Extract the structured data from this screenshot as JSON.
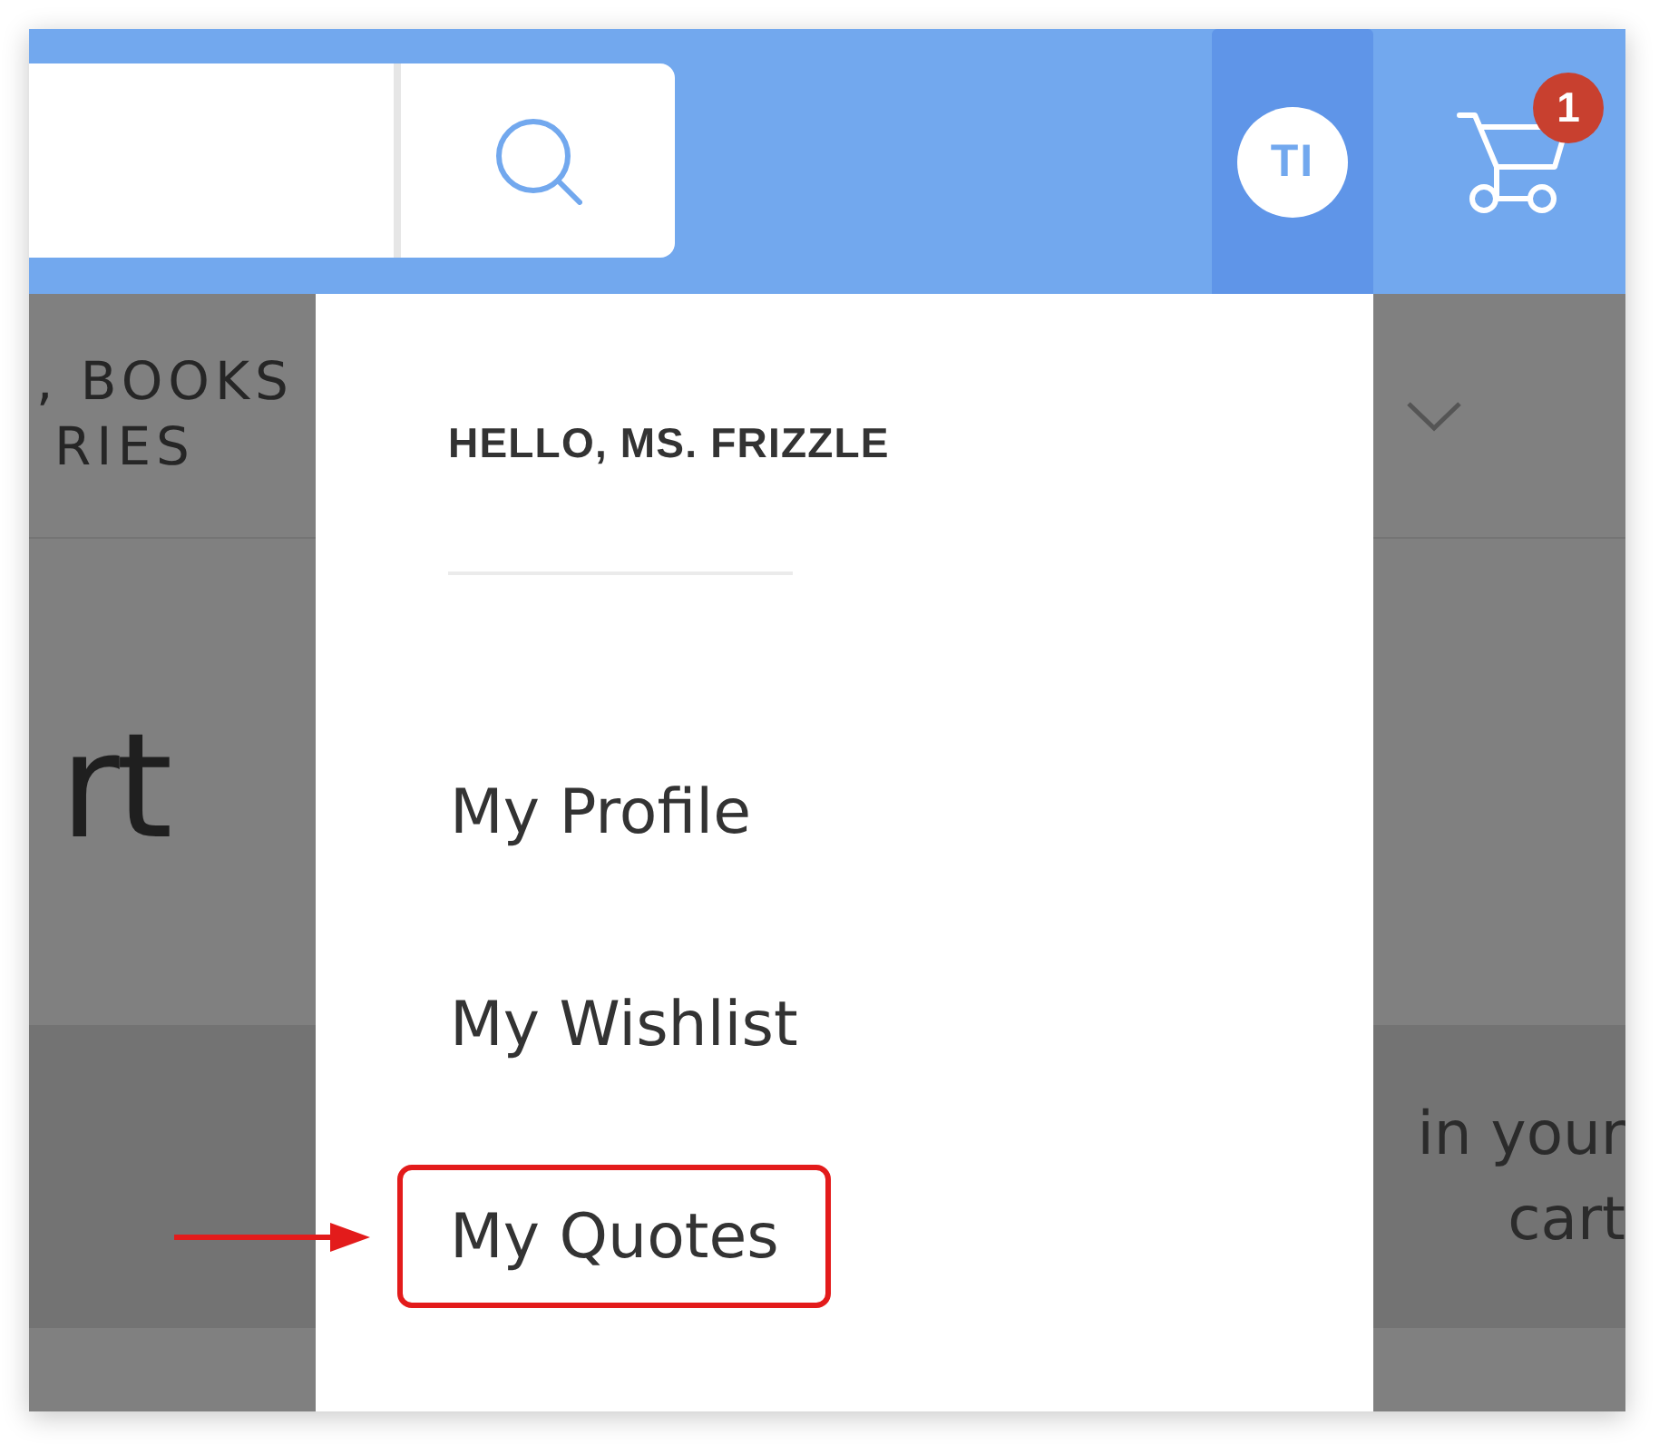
{
  "header": {
    "account": {
      "initials": "TI",
      "expanded": true
    },
    "cart": {
      "count": "1"
    }
  },
  "page_behind": {
    "category_label_lines": [
      ", BOOKS",
      "RIES"
    ],
    "heading": "rt",
    "cart_message": "in your cart"
  },
  "account_menu": {
    "greeting": "HELLO, MS. FRIZZLE",
    "items": [
      {
        "label": "My Profile",
        "highlighted": false
      },
      {
        "label": "My Wishlist",
        "highlighted": false
      },
      {
        "label": "My Quotes",
        "highlighted": true
      }
    ]
  }
}
